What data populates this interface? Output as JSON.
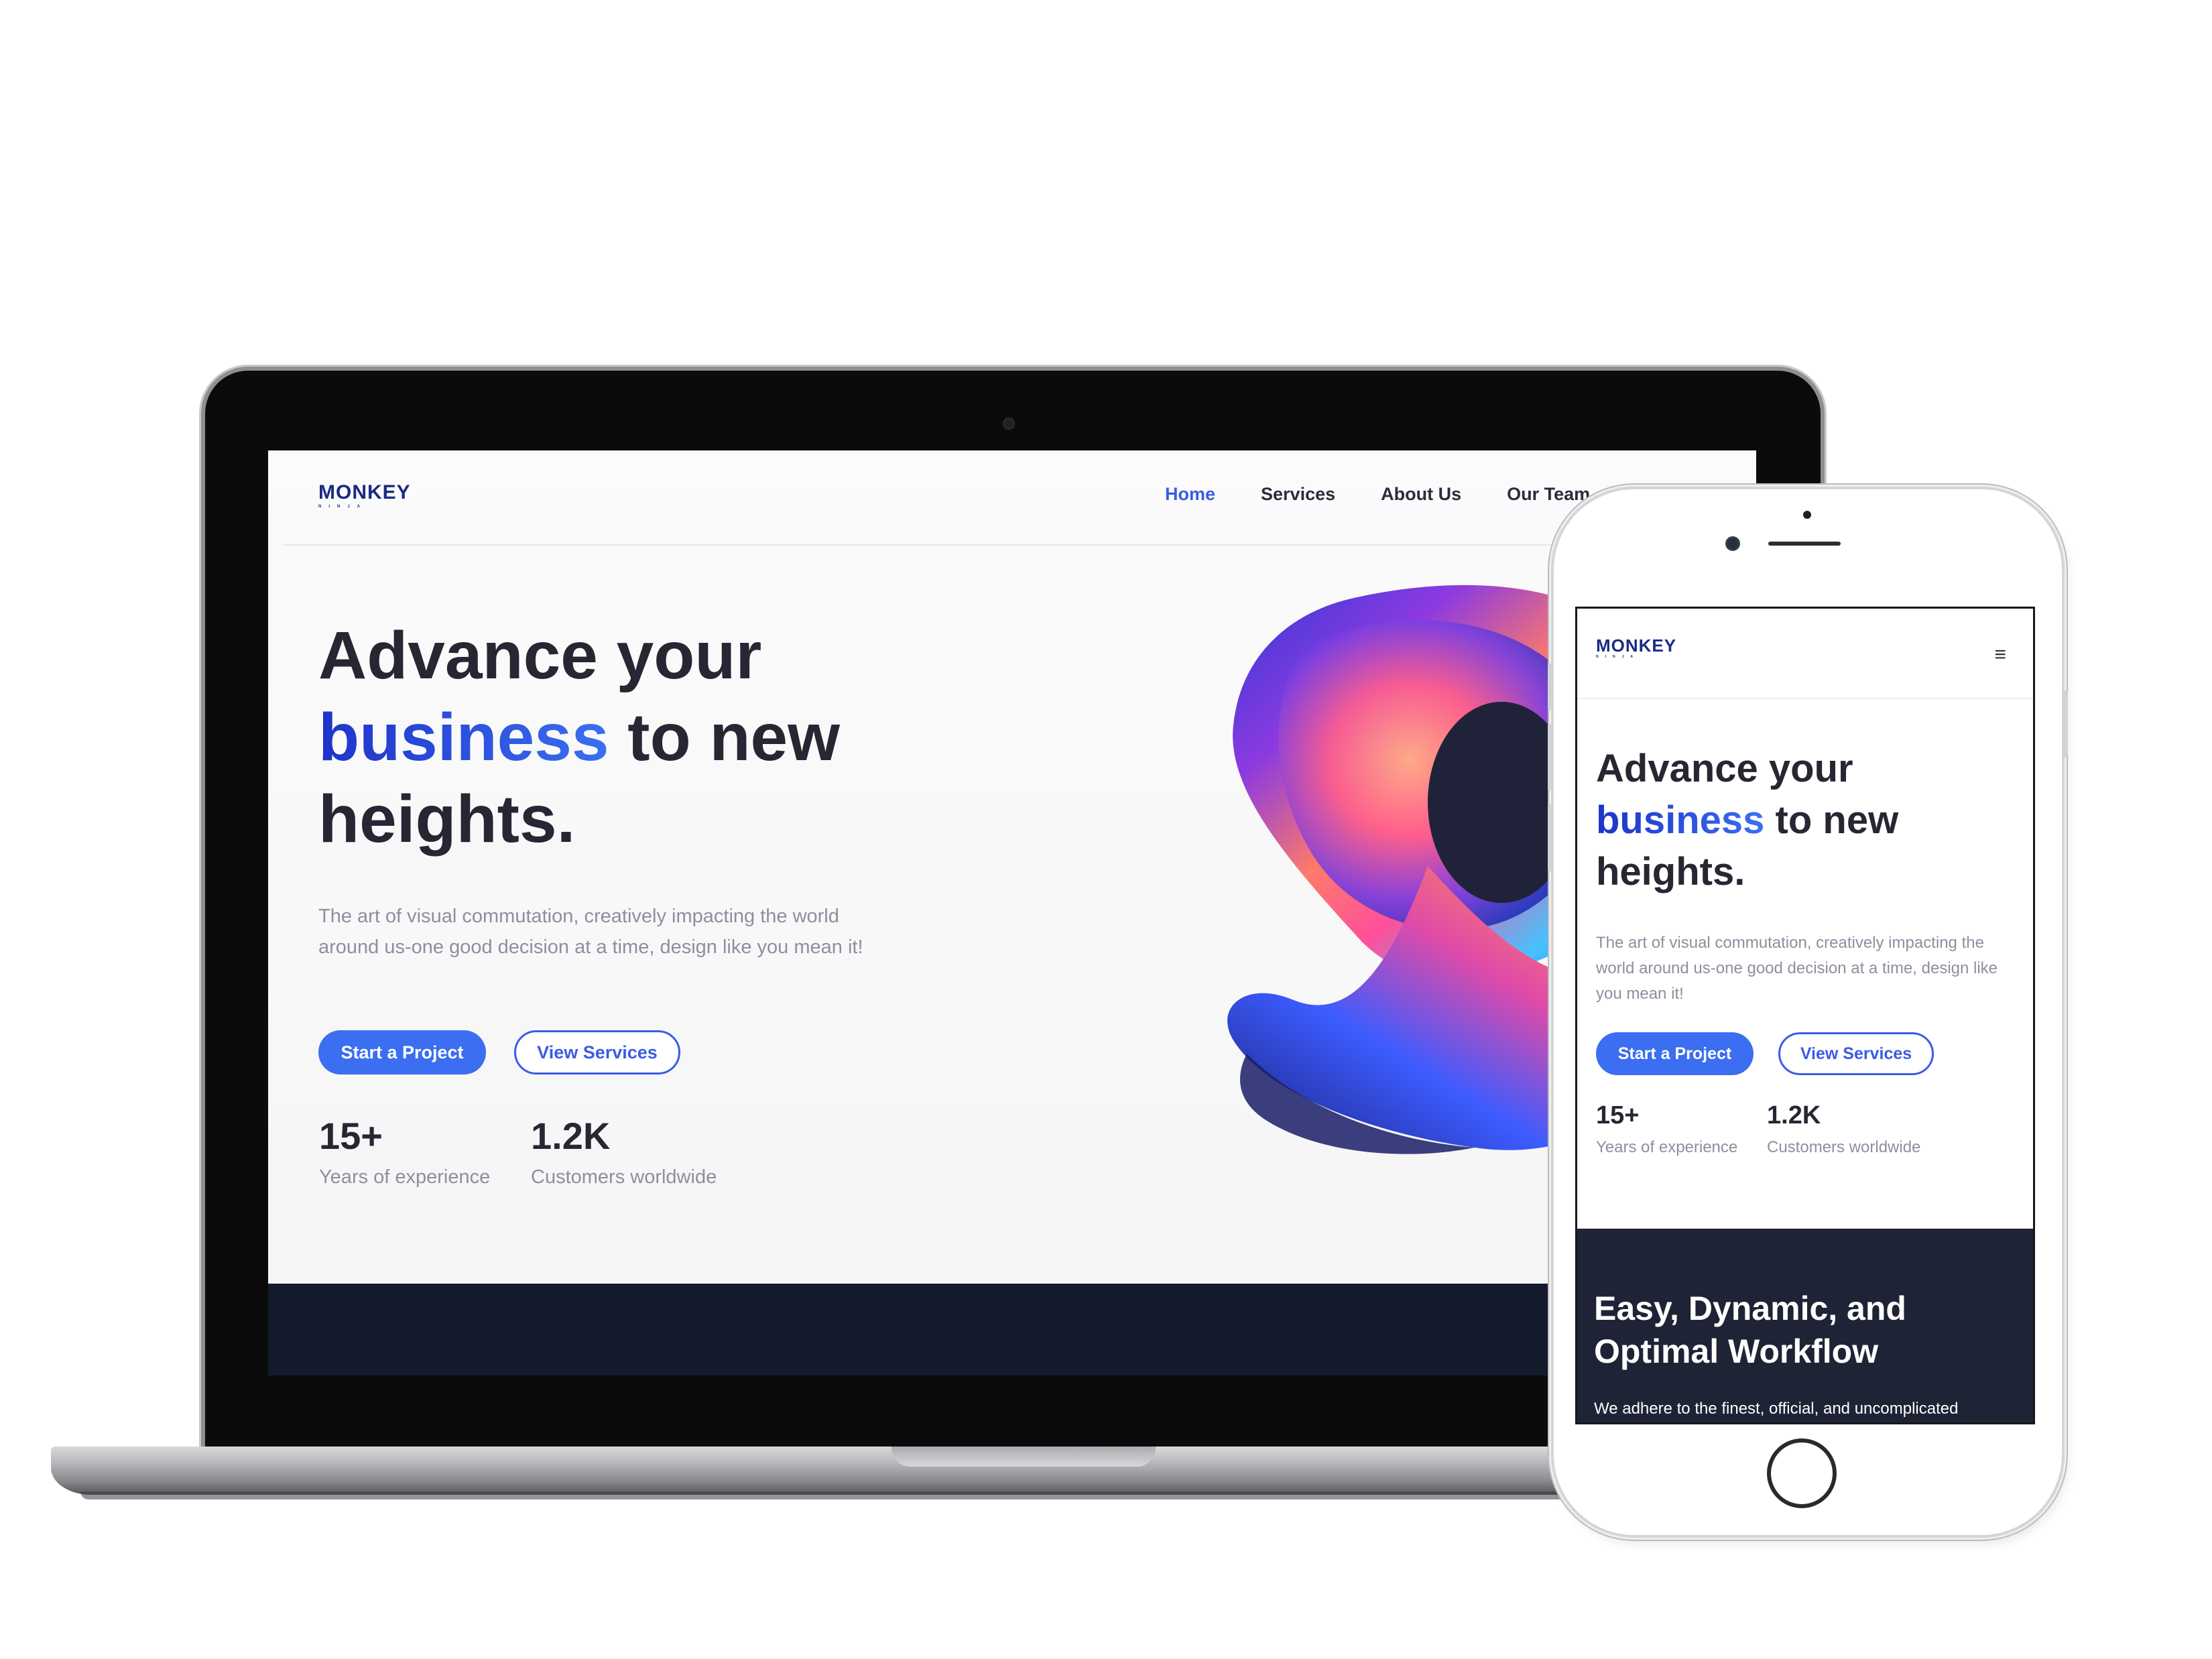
{
  "brand": {
    "name": "MONKEY",
    "tagline": "NINJA"
  },
  "nav": {
    "items": [
      {
        "label": "Home",
        "active": true
      },
      {
        "label": "Services"
      },
      {
        "label": "About Us"
      },
      {
        "label": "Our Team"
      }
    ]
  },
  "hero": {
    "title_line1": "Advance your",
    "title_accent": "business",
    "title_rest": " to new",
    "title_line3": "heights.",
    "description": "The art of visual commutation, creatively impacting the world around us-one good decision at a time, design like you mean it!",
    "primary_button": "Start a Project",
    "secondary_button": "View Services"
  },
  "stats": [
    {
      "value": "15+",
      "label": "Years of experience"
    },
    {
      "value": "1.2K",
      "label": "Customers worldwide"
    }
  ],
  "workflow": {
    "title": "Easy, Dynamic, and Optimal Workflow",
    "text": "We adhere to the finest, official, and uncomplicated"
  },
  "colors": {
    "accent": "#3b6ef0",
    "brand": "#1b2a83",
    "dark_section": "#1e2435",
    "heading": "#262733",
    "muted_text": "#8d8f9e"
  },
  "icons": {
    "menu": "hamburger-menu-icon"
  }
}
